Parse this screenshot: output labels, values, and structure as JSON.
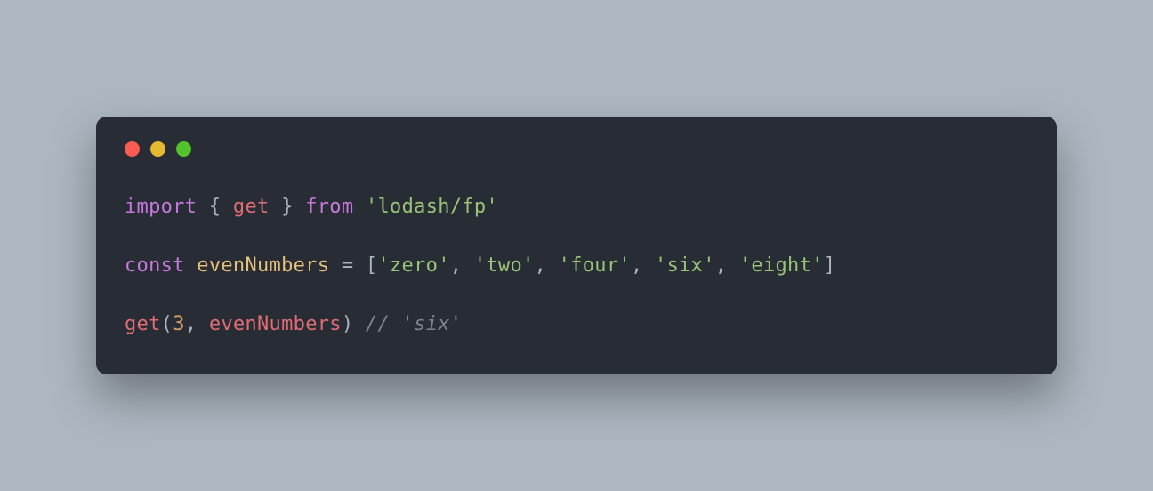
{
  "code": {
    "line1": {
      "import": "import",
      "braceOpen": " { ",
      "fn": "get",
      "braceClose": " } ",
      "from": "from",
      "space": " ",
      "module": "'lodash/fp'"
    },
    "line3": {
      "const": "const",
      "space": " ",
      "ident": "evenNumbers",
      "eq": " = ",
      "bracketOpen": "[",
      "s0": "'zero'",
      "c0": ", ",
      "s1": "'two'",
      "c1": ", ",
      "s2": "'four'",
      "c2": ", ",
      "s3": "'six'",
      "c3": ", ",
      "s4": "'eight'",
      "bracketClose": "]"
    },
    "line5": {
      "call": "get",
      "parenOpen": "(",
      "num": "3",
      "comma": ", ",
      "ident": "evenNumbers",
      "parenClose": ")",
      "space": " ",
      "comment": "// 'six'"
    }
  }
}
